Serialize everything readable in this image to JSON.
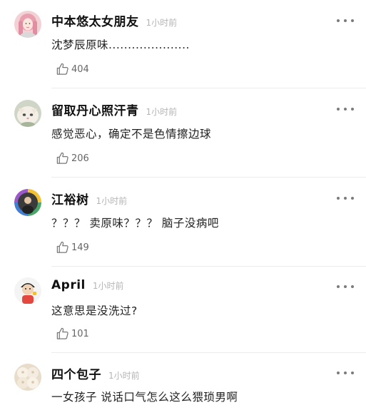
{
  "comments": [
    {
      "username": "中本悠太女朋友",
      "time": "1小时前",
      "text": "沈梦辰原味.....................",
      "likes": "404",
      "avatar": "pink-hair-girl"
    },
    {
      "username": "留取丹心照汗青",
      "time": "1小时前",
      "text": "感觉恶心，确定不是色情擦边球",
      "likes": "206",
      "avatar": "white-cat"
    },
    {
      "username": "江裕树",
      "time": "1小时前",
      "text": "？？？ 卖原味？？？ 脑子没病吧",
      "likes": "149",
      "avatar": "rainbow-ring"
    },
    {
      "username": "April",
      "time": "1小时前",
      "text": "这意思是没洗过?",
      "likes": "101",
      "avatar": "cartoon-person"
    },
    {
      "username": "四个包子",
      "time": "1小时前",
      "text": "一女孩子 说话口气怎么这么猥琐男啊",
      "likes": "",
      "avatar": "steamed-buns"
    }
  ],
  "icons": {
    "like": "thumbs-up-outline-icon",
    "more": "more-dots-icon"
  },
  "colors": {
    "username": "#111111",
    "time": "#b5b5b5",
    "text": "#222222",
    "count": "#666666",
    "divider": "#ececec"
  }
}
